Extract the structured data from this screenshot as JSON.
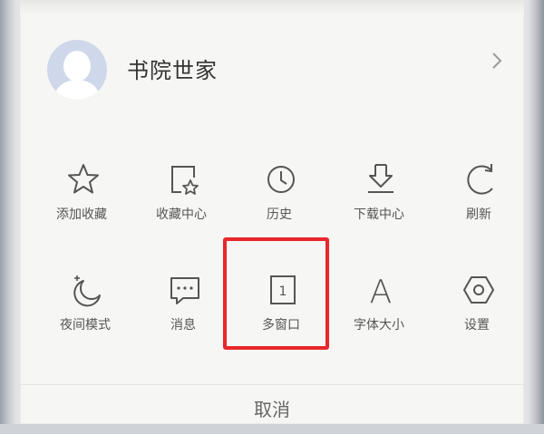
{
  "profile": {
    "name": "书院世家"
  },
  "menu": {
    "row1": [
      {
        "label": "添加收藏",
        "icon": "star-icon"
      },
      {
        "label": "收藏中心",
        "icon": "bookmark-center-icon"
      },
      {
        "label": "历史",
        "icon": "clock-icon"
      },
      {
        "label": "下载中心",
        "icon": "download-icon"
      },
      {
        "label": "刷新",
        "icon": "refresh-icon"
      }
    ],
    "row2": [
      {
        "label": "夜间模式",
        "icon": "moon-icon"
      },
      {
        "label": "消息",
        "icon": "message-icon"
      },
      {
        "label": "多窗口",
        "icon": "window-icon",
        "badge": "1"
      },
      {
        "label": "字体大小",
        "icon": "font-size-icon",
        "glyph": "A"
      },
      {
        "label": "设置",
        "icon": "settings-icon"
      }
    ]
  },
  "cancel_label": "取消",
  "colors": {
    "highlight": "#e8262b",
    "background": "#f6f6f4",
    "icon_stroke": "#555555"
  }
}
